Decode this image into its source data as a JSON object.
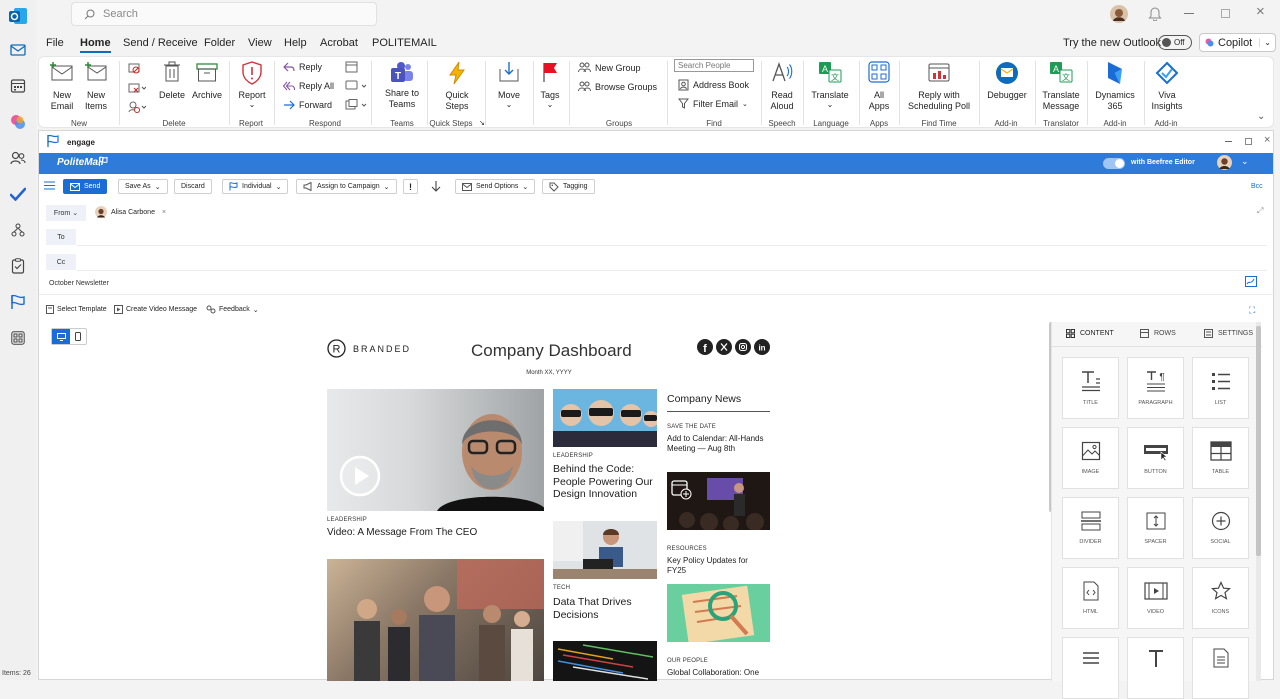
{
  "search": {
    "placeholder": "Search"
  },
  "menu": [
    "File",
    "Home",
    "Send / Receive",
    "Folder",
    "View",
    "Help",
    "Acrobat",
    "POLITEMAIL"
  ],
  "titlebar": {
    "try_new": "Try the new Outlook",
    "toggle": "Off",
    "copilot": "Copilot"
  },
  "ribbon": {
    "new_email": "New Email",
    "new_items": "New Items",
    "delete": "Delete",
    "archive": "Archive",
    "report": "Report",
    "reply": "Reply",
    "reply_all": "Reply All",
    "forward": "Forward",
    "share_teams": "Share to Teams",
    "quick_steps": "Quick Steps",
    "move": "Move",
    "tags": "Tags",
    "new_group": "New Group",
    "browse_groups": "Browse Groups",
    "search_people": "Search People",
    "address_book": "Address Book",
    "filter_email": "Filter Email",
    "read_aloud": "Read Aloud",
    "translate": "Translate",
    "all_apps": "All Apps",
    "reply_poll": "Reply with Scheduling Poll",
    "debugger": "Debugger",
    "translate_msg": "Translate Message",
    "dynamics": "Dynamics 365",
    "viva": "Viva Insights",
    "groups_labels": [
      "New",
      "Delete",
      "Report",
      "Respond",
      "Teams",
      "Quick Steps",
      "Groups",
      "Find",
      "Speech",
      "Language",
      "Apps",
      "Find Time",
      "Add-in",
      "Translator",
      "Add-in",
      "Add-in"
    ]
  },
  "compose": {
    "window_title": "engage",
    "brand": "PoliteMail",
    "editor_label": "with Beefree Editor",
    "toolbar": {
      "send": "Send",
      "save_as": "Save As",
      "discard": "Discard",
      "individual": "Individual",
      "campaign": "Assign to Campaign",
      "priority": "!",
      "send_options": "Send Options",
      "tagging": "Tagging",
      "bcc": "Bcc"
    },
    "from_label": "From",
    "from_name": "Alisa Carbone",
    "to_label": "To",
    "cc_label": "Cc",
    "subject": "October Newsletter",
    "select_template": "Select Template",
    "create_video": "Create Video Message",
    "feedback": "Feedback"
  },
  "newsletter": {
    "brand": "BRANDED",
    "title": "Company Dashboard",
    "date": "Month XX, YYYY",
    "social": [
      "facebook",
      "x",
      "instagram",
      "linkedin"
    ],
    "col1": [
      {
        "cat": "LEADERSHIP",
        "head": "Video: A Message From The CEO"
      }
    ],
    "col2": [
      {
        "cat": "LEADERSHIP",
        "head": "Behind the Code: People Powering Our Design Innovation"
      },
      {
        "cat": "TECH",
        "head": "Data That Drives Decisions"
      }
    ],
    "news_title": "Company News",
    "col3": [
      {
        "cat": "SAVE THE DATE",
        "head": "Add to Calendar: All-Hands Meeting — Aug 8th"
      },
      {
        "cat": "RESOURCES",
        "head": "Key Policy Updates for FY25"
      },
      {
        "cat": "OUR PEOPLE",
        "head": "Global Collaboration: One"
      }
    ]
  },
  "panel": {
    "tabs": [
      "CONTENT",
      "ROWS",
      "SETTINGS"
    ],
    "tiles": [
      "TITLE",
      "PARAGRAPH",
      "LIST",
      "IMAGE",
      "BUTTON",
      "TABLE",
      "DIVIDER",
      "SPACER",
      "SOCIAL",
      "HTML",
      "VIDEO",
      "ICONS"
    ]
  },
  "status": {
    "items": "Items: 26"
  },
  "colors": {
    "accent": "#0f6cbd",
    "politemail_bar": "#2f7bd9",
    "send_button": "#1a6dd6"
  }
}
